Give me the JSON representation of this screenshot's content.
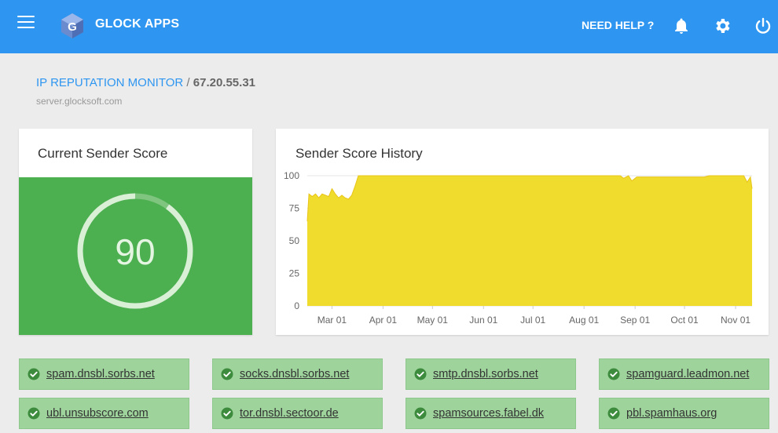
{
  "header": {
    "app_name": "GLOCK APPS",
    "help_label": "NEED HELP ?",
    "icons": [
      "menu-icon",
      "glock-logo",
      "bell-icon",
      "gear-icon",
      "power-icon"
    ],
    "color": "#2e96f0"
  },
  "breadcrumb": {
    "section": "IP REPUTATION MONITOR",
    "separator": "/",
    "ip": "67.20.55.31",
    "hostname": "server.glocksoft.com"
  },
  "current_score": {
    "title": "Current Sender Score",
    "value": "90",
    "score_number": 90,
    "max": 100,
    "panel_color": "#4caf50"
  },
  "history": {
    "title": "Sender Score History"
  },
  "chart_data": {
    "type": "area",
    "title": "Sender Score History",
    "xlabel": "",
    "ylabel": "",
    "ylim": [
      0,
      100
    ],
    "yticks": [
      0,
      25,
      50,
      75,
      100
    ],
    "xticks": [
      "Mar 01",
      "Apr 01",
      "May 01",
      "Jun 01",
      "Jul 01",
      "Aug 01",
      "Sep 01",
      "Oct 01",
      "Nov 01"
    ],
    "fill_color": "#f0dc2c",
    "line_color": "#e8c419",
    "grid": true,
    "x": [
      "Feb 14",
      "Feb 15",
      "Feb 17",
      "Feb 19",
      "Feb 21",
      "Feb 23",
      "Feb 25",
      "Feb 27",
      "Mar 01",
      "Mar 03",
      "Mar 05",
      "Mar 07",
      "Mar 09",
      "Mar 11",
      "Mar 13",
      "Mar 15",
      "Mar 17",
      "Mar 19",
      "Mar 21",
      "Apr 01",
      "May 01",
      "Jun 01",
      "Jul 01",
      "Aug 01",
      "Aug 23",
      "Aug 25",
      "Aug 28",
      "Aug 30",
      "Sep 02",
      "Sep 15",
      "Oct 01",
      "Oct 10",
      "Oct 13",
      "Oct 16",
      "Nov 01",
      "Nov 03",
      "Nov 06",
      "Nov 08",
      "Nov 10",
      "Nov 11"
    ],
    "values": [
      65,
      86,
      84,
      86,
      83,
      86,
      85,
      84,
      90,
      86,
      83,
      85,
      83,
      82,
      85,
      92,
      100,
      100,
      100,
      100,
      100,
      100,
      100,
      100,
      100,
      98,
      100,
      96,
      99,
      99,
      99,
      99,
      99,
      100,
      100,
      100,
      100,
      95,
      99,
      90
    ]
  },
  "blacklists": [
    {
      "name": "spam.dnsbl.sorbs.net",
      "status": "clean"
    },
    {
      "name": "socks.dnsbl.sorbs.net",
      "status": "clean"
    },
    {
      "name": "smtp.dnsbl.sorbs.net",
      "status": "clean"
    },
    {
      "name": "spamguard.leadmon.net",
      "status": "clean"
    },
    {
      "name": "ubl.unsubscore.com",
      "status": "clean"
    },
    {
      "name": "tor.dnsbl.sectoor.de",
      "status": "clean"
    },
    {
      "name": "spamsources.fabel.dk",
      "status": "clean"
    },
    {
      "name": "pbl.spamhaus.org",
      "status": "clean"
    }
  ]
}
